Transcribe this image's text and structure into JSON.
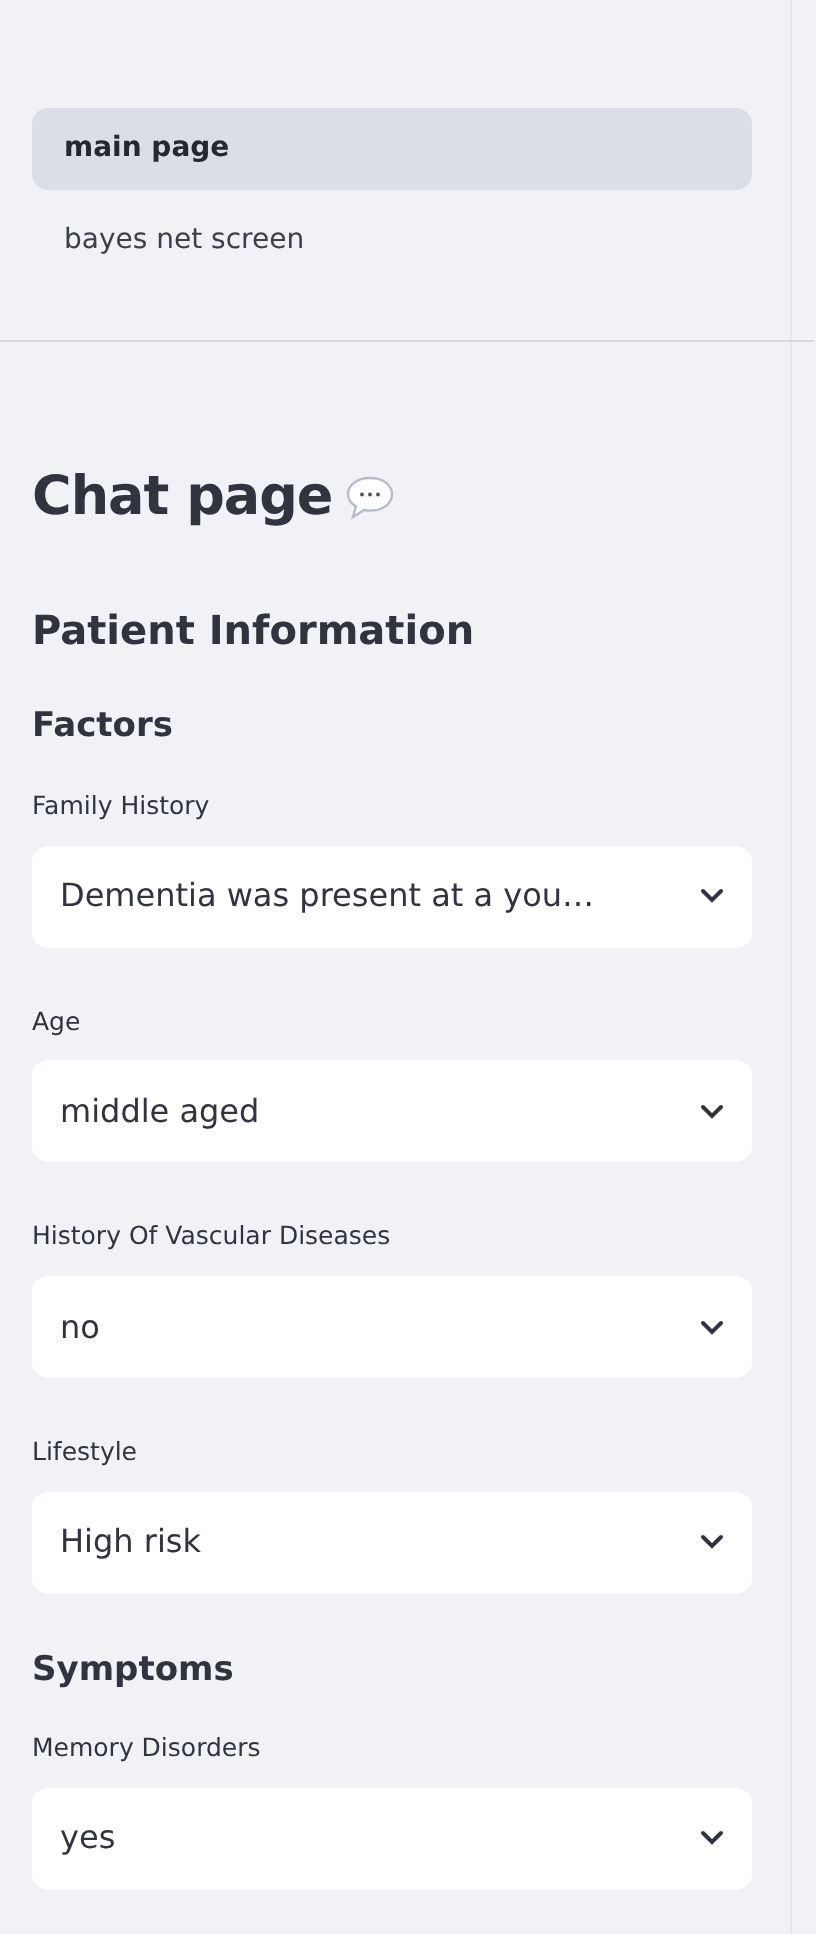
{
  "nav": {
    "items": [
      {
        "label": "main page",
        "selected": true
      },
      {
        "label": "bayes net screen",
        "selected": false
      }
    ]
  },
  "page_title": "Chat page",
  "form": [
    {
      "kind": "subheading",
      "text": "Patient Information"
    },
    {
      "kind": "section",
      "text": "Factors"
    },
    {
      "kind": "select",
      "label": "Family History",
      "value": "Dementia was present at a you…"
    },
    {
      "kind": "select",
      "label": "Age",
      "value": "middle aged"
    },
    {
      "kind": "select",
      "label": "History Of Vascular Diseases",
      "value": "no"
    },
    {
      "kind": "select",
      "label": "Lifestyle",
      "value": "High risk"
    },
    {
      "kind": "section",
      "text": "Symptoms"
    },
    {
      "kind": "select",
      "label": "Memory Disorders",
      "value": "yes"
    }
  ]
}
